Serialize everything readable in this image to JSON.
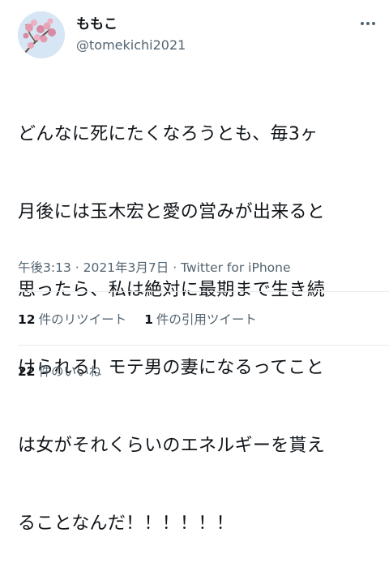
{
  "user": {
    "display_name": "ももこ",
    "handle": "@tomekichi2021"
  },
  "icons": {
    "avatar": "cherry-blossom-avatar",
    "more": "more-dots-icon"
  },
  "tweet": {
    "lines": [
      "どんなに死にたくなろうとも、毎3ヶ",
      "月後には玉木宏と愛の営みが出来ると",
      "思ったら、私は絶対に最期まで生き続",
      "けられる！モテ男の妻になるってこと",
      "は女がそれくらいのエネルギーを貰え",
      "ることなんだ！！！！！！"
    ]
  },
  "meta": {
    "time": "午後3:13",
    "separator1": " · ",
    "date": "2021年3月7日",
    "separator2": " · ",
    "source": "Twitter for iPhone"
  },
  "stats": {
    "retweets": {
      "count": "12",
      "label": "件のリツイート"
    },
    "quotes": {
      "count": "1",
      "label": "件の引用ツイート"
    },
    "likes": {
      "count": "22",
      "label": "件のいいね"
    }
  },
  "colors": {
    "text_primary": "#0f1419",
    "text_secondary": "#536471",
    "divider": "#e6e9ec"
  }
}
